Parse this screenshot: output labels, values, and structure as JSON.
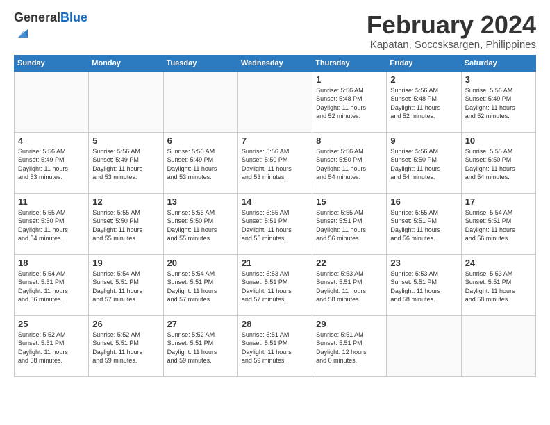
{
  "logo": {
    "general": "General",
    "blue": "Blue"
  },
  "title": "February 2024",
  "subtitle": "Kapatan, Soccsksargen, Philippines",
  "days_of_week": [
    "Sunday",
    "Monday",
    "Tuesday",
    "Wednesday",
    "Thursday",
    "Friday",
    "Saturday"
  ],
  "weeks": [
    [
      {
        "day": "",
        "info": ""
      },
      {
        "day": "",
        "info": ""
      },
      {
        "day": "",
        "info": ""
      },
      {
        "day": "",
        "info": ""
      },
      {
        "day": "1",
        "info": "Sunrise: 5:56 AM\nSunset: 5:48 PM\nDaylight: 11 hours\nand 52 minutes."
      },
      {
        "day": "2",
        "info": "Sunrise: 5:56 AM\nSunset: 5:48 PM\nDaylight: 11 hours\nand 52 minutes."
      },
      {
        "day": "3",
        "info": "Sunrise: 5:56 AM\nSunset: 5:49 PM\nDaylight: 11 hours\nand 52 minutes."
      }
    ],
    [
      {
        "day": "4",
        "info": "Sunrise: 5:56 AM\nSunset: 5:49 PM\nDaylight: 11 hours\nand 53 minutes."
      },
      {
        "day": "5",
        "info": "Sunrise: 5:56 AM\nSunset: 5:49 PM\nDaylight: 11 hours\nand 53 minutes."
      },
      {
        "day": "6",
        "info": "Sunrise: 5:56 AM\nSunset: 5:49 PM\nDaylight: 11 hours\nand 53 minutes."
      },
      {
        "day": "7",
        "info": "Sunrise: 5:56 AM\nSunset: 5:50 PM\nDaylight: 11 hours\nand 53 minutes."
      },
      {
        "day": "8",
        "info": "Sunrise: 5:56 AM\nSunset: 5:50 PM\nDaylight: 11 hours\nand 54 minutes."
      },
      {
        "day": "9",
        "info": "Sunrise: 5:56 AM\nSunset: 5:50 PM\nDaylight: 11 hours\nand 54 minutes."
      },
      {
        "day": "10",
        "info": "Sunrise: 5:55 AM\nSunset: 5:50 PM\nDaylight: 11 hours\nand 54 minutes."
      }
    ],
    [
      {
        "day": "11",
        "info": "Sunrise: 5:55 AM\nSunset: 5:50 PM\nDaylight: 11 hours\nand 54 minutes."
      },
      {
        "day": "12",
        "info": "Sunrise: 5:55 AM\nSunset: 5:50 PM\nDaylight: 11 hours\nand 55 minutes."
      },
      {
        "day": "13",
        "info": "Sunrise: 5:55 AM\nSunset: 5:50 PM\nDaylight: 11 hours\nand 55 minutes."
      },
      {
        "day": "14",
        "info": "Sunrise: 5:55 AM\nSunset: 5:51 PM\nDaylight: 11 hours\nand 55 minutes."
      },
      {
        "day": "15",
        "info": "Sunrise: 5:55 AM\nSunset: 5:51 PM\nDaylight: 11 hours\nand 56 minutes."
      },
      {
        "day": "16",
        "info": "Sunrise: 5:55 AM\nSunset: 5:51 PM\nDaylight: 11 hours\nand 56 minutes."
      },
      {
        "day": "17",
        "info": "Sunrise: 5:54 AM\nSunset: 5:51 PM\nDaylight: 11 hours\nand 56 minutes."
      }
    ],
    [
      {
        "day": "18",
        "info": "Sunrise: 5:54 AM\nSunset: 5:51 PM\nDaylight: 11 hours\nand 56 minutes."
      },
      {
        "day": "19",
        "info": "Sunrise: 5:54 AM\nSunset: 5:51 PM\nDaylight: 11 hours\nand 57 minutes."
      },
      {
        "day": "20",
        "info": "Sunrise: 5:54 AM\nSunset: 5:51 PM\nDaylight: 11 hours\nand 57 minutes."
      },
      {
        "day": "21",
        "info": "Sunrise: 5:53 AM\nSunset: 5:51 PM\nDaylight: 11 hours\nand 57 minutes."
      },
      {
        "day": "22",
        "info": "Sunrise: 5:53 AM\nSunset: 5:51 PM\nDaylight: 11 hours\nand 58 minutes."
      },
      {
        "day": "23",
        "info": "Sunrise: 5:53 AM\nSunset: 5:51 PM\nDaylight: 11 hours\nand 58 minutes."
      },
      {
        "day": "24",
        "info": "Sunrise: 5:53 AM\nSunset: 5:51 PM\nDaylight: 11 hours\nand 58 minutes."
      }
    ],
    [
      {
        "day": "25",
        "info": "Sunrise: 5:52 AM\nSunset: 5:51 PM\nDaylight: 11 hours\nand 58 minutes."
      },
      {
        "day": "26",
        "info": "Sunrise: 5:52 AM\nSunset: 5:51 PM\nDaylight: 11 hours\nand 59 minutes."
      },
      {
        "day": "27",
        "info": "Sunrise: 5:52 AM\nSunset: 5:51 PM\nDaylight: 11 hours\nand 59 minutes."
      },
      {
        "day": "28",
        "info": "Sunrise: 5:51 AM\nSunset: 5:51 PM\nDaylight: 11 hours\nand 59 minutes."
      },
      {
        "day": "29",
        "info": "Sunrise: 5:51 AM\nSunset: 5:51 PM\nDaylight: 12 hours\nand 0 minutes."
      },
      {
        "day": "",
        "info": ""
      },
      {
        "day": "",
        "info": ""
      }
    ]
  ]
}
